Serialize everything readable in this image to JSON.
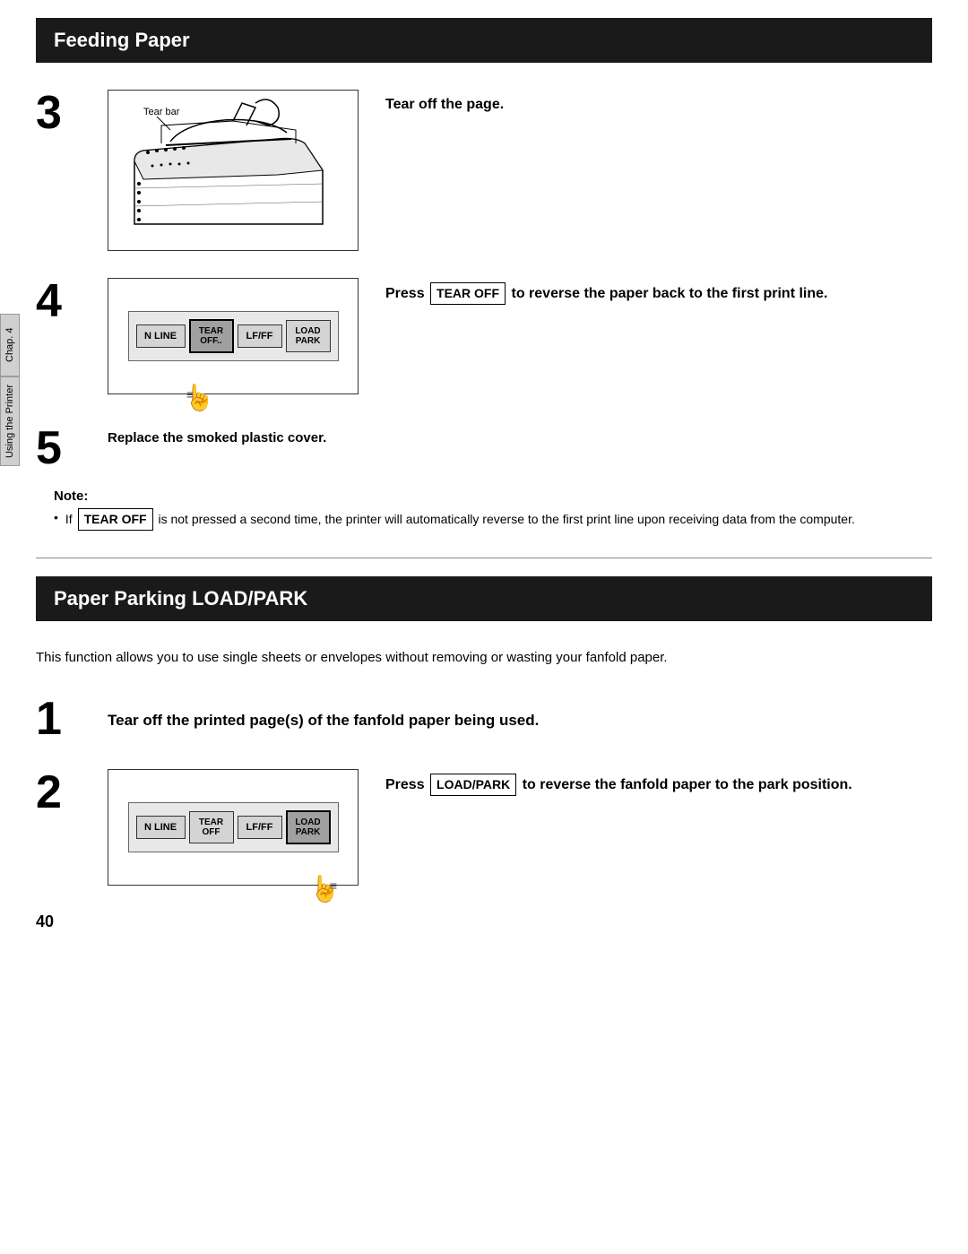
{
  "page": {
    "number": "40"
  },
  "sections": {
    "feeding_paper": {
      "title": "Feeding Paper"
    },
    "paper_parking": {
      "title": "Paper Parking  LOAD/PARK"
    }
  },
  "side_tabs": {
    "chap": "Chap. 4",
    "using": "Using the Printer"
  },
  "steps": {
    "step3": {
      "number": "3",
      "description": "Tear off the page.",
      "image_label": "Tear bar"
    },
    "step4": {
      "number": "4",
      "description_prefix": "Press",
      "button_label": "TEAR OFF",
      "description_suffix": "to reverse the paper back to the first print line.",
      "buttons": {
        "n_line": "N LINE",
        "tear_off": "TEAR\nOFF..",
        "lf_ff": "LF/FF",
        "load_park": "LOAD\nPARK"
      }
    },
    "step5": {
      "number": "5",
      "description": "Replace the smoked plastic cover."
    },
    "note": {
      "title": "Note:",
      "text_prefix": "If",
      "button_label": "TEAR OFF",
      "text_suffix": "is not pressed a second time, the printer will automatically reverse to the first print line upon receiving data from the computer."
    },
    "parking_step1": {
      "number": "1",
      "description": "Tear off the printed page(s) of the fanfold paper being used."
    },
    "parking_step2": {
      "number": "2",
      "description_prefix": "Press",
      "button_label": "LOAD/PARK",
      "description_suffix": "to reverse the fanfold paper to the park position.",
      "buttons": {
        "n_line": "N LINE",
        "tear_off": "TEAR\nOFF",
        "lf_ff": "LF/FF",
        "load_park": "LOAD\nPARK"
      }
    }
  },
  "paper_parking_description": "This function allows you to use single sheets or envelopes without removing or wasting your fanfold paper."
}
